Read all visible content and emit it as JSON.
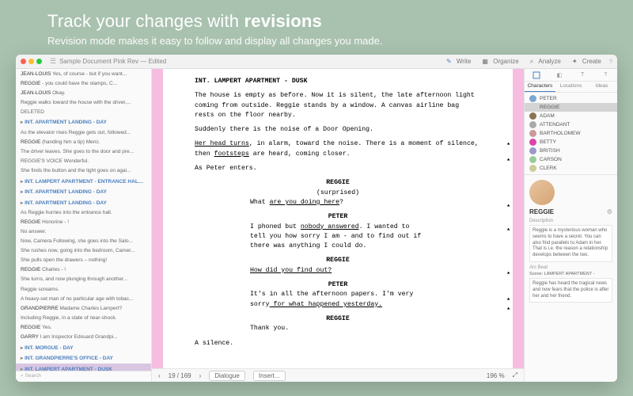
{
  "hero": {
    "title_a": "Track your changes with ",
    "title_b": "revisions",
    "sub": "Revision mode makes it easy to follow and display all changes you made."
  },
  "win": {
    "title": "Sample Document Pink Rev — Edited"
  },
  "tools": {
    "write": "Write",
    "organize": "Organize",
    "analyze": "Analyze",
    "create": "Create"
  },
  "outline": [
    {
      "t": "line",
      "ch": "JEAN-LOUIS",
      "txt": "Yes, of course - but if you want..."
    },
    {
      "t": "line",
      "ch": "REGGIE",
      "txt": "- you could have the stamps, C..."
    },
    {
      "t": "line",
      "ch": "JEAN-LOUIS",
      "txt": "Okay."
    },
    {
      "t": "line",
      "ch": "",
      "txt": "Reggie walks toward the house with the driver,..."
    },
    {
      "t": "line",
      "ch": "",
      "txt": "DELETED"
    },
    {
      "t": "sh",
      "txt": "INT. APARTMENT LANDING - DAY"
    },
    {
      "t": "line",
      "ch": "",
      "txt": "As the elevator rises Reggie gets out, followed..."
    },
    {
      "t": "line",
      "ch": "REGGIE",
      "txt": "(handing him a tip)  Merci."
    },
    {
      "t": "line",
      "ch": "",
      "txt": "The driver leaves. She goes to the door and pre..."
    },
    {
      "t": "line",
      "ch": "",
      "txt": "REGGIE'S VOICE Wonderful."
    },
    {
      "t": "line",
      "ch": "",
      "txt": "She finds the button and the light goes on agai..."
    },
    {
      "t": "sh",
      "txt": "INT. LAMPERT APARTMENT - ENTRANCE HALL -..."
    },
    {
      "t": "sh",
      "txt": "INT. APARTMENT LANDING - DAY"
    },
    {
      "t": "sh",
      "txt": "INT. APARTMENT LANDING - DAY"
    },
    {
      "t": "line",
      "ch": "",
      "txt": "As Reggie hurries into the entrance hall."
    },
    {
      "t": "line",
      "ch": "REGGIE",
      "txt": "Honorine - !"
    },
    {
      "t": "line",
      "ch": "",
      "txt": "No answer."
    },
    {
      "t": "line",
      "ch": "",
      "txt": "Now, Camera Following, she goes into the Salo..."
    },
    {
      "t": "line",
      "ch": "",
      "txt": "She rushes now, going into the bedroom, Camer..."
    },
    {
      "t": "line",
      "ch": "",
      "txt": "She pulls open the drawers – nothing!"
    },
    {
      "t": "line",
      "ch": "REGGIE",
      "txt": "Charles - !"
    },
    {
      "t": "line",
      "ch": "",
      "txt": "She turns, and now plunging through another..."
    },
    {
      "t": "line",
      "ch": "",
      "txt": "Reggie screams."
    },
    {
      "t": "line",
      "ch": "",
      "txt": "A heavy-set man of no particular age with tobac..."
    },
    {
      "t": "line",
      "ch": "GRANDPIERRE",
      "txt": "Madame Charles Lampert?"
    },
    {
      "t": "line",
      "ch": "",
      "txt": "Including Reggie, in a state of near-shock."
    },
    {
      "t": "line",
      "ch": "REGGIE",
      "txt": "Yes."
    },
    {
      "t": "line",
      "ch": "GARRY",
      "txt": "I am Inspector Edouard Grandpi..."
    },
    {
      "t": "sh",
      "txt": "INT. MORGUE - DAY"
    },
    {
      "t": "sh",
      "txt": "INT. GRANDPIERRE'S OFFICE - DAY"
    },
    {
      "t": "sh",
      "txt": "INT. LAMPERT APARTMENT - DUSK",
      "sel": true
    }
  ],
  "search_ph": "Search",
  "script": {
    "slug": "INT. LAMPERT APARTMENT - DUSK",
    "a1": "The house is empty as before. Now it is silent, the late afternoon light coming from outside. Reggie stands by a window. A canvas airline bag rests on the floor nearby.",
    "a2": "Suddenly there is the noise of a Door Opening.",
    "a3_a": "Her head turns",
    "a3_b": ", in alarm, toward the noise. There is a moment of silence, then ",
    "a3_c": "footsteps",
    "a3_d": " are heard, coming closer.",
    "a4": "As Peter enters.",
    "c1": "REGGIE",
    "p1": "(surprised)",
    "d1a": "What ",
    "d1b": "are you doing here",
    "d1c": "?",
    "c2": "PETER",
    "d2a": "I phoned but ",
    "d2b": "nobody answered",
    "d2c": ". I wanted to tell you how sorry I am - and to find out if there was anything I could do.",
    "c3": "REGGIE",
    "d3": "How did you find out?",
    "c4": "PETER",
    "d4a": "It's in all the afternoon papers. I'm very sorry",
    "d4b": " for what happened yesterday.",
    "c5": "REGGIE",
    "d5": "Thank you.",
    "a5": "A silence."
  },
  "bottom": {
    "pages": "19 / 169",
    "element": "Dialogue",
    "insert": "Insert...",
    "zoom": "196 %"
  },
  "sidetabs": {
    "characters": "Characters",
    "locations": "Locations",
    "ideas": "Ideas"
  },
  "chars": [
    {
      "n": "PETER",
      "c": "#7aa7d4"
    },
    {
      "n": "REGGIE",
      "c": "#d4d4d4",
      "sel": true
    },
    {
      "n": "ADAM",
      "c": "#8b7355"
    },
    {
      "n": "ATTENDANT",
      "c": "#aaa"
    },
    {
      "n": "BARTHOLOMEW",
      "c": "#c99"
    },
    {
      "n": "BETTY",
      "c": "#d4a"
    },
    {
      "n": "BRITISH",
      "c": "#99c"
    },
    {
      "n": "CARSON",
      "c": "#9c9"
    },
    {
      "n": "CLERK",
      "c": "#cc9"
    }
  ],
  "detail": {
    "name": "REGGIE",
    "desc_lbl": "Description",
    "desc": "Reggie is a mysterious woman who seems to have a secret. You can also find parallels to Adam in her. That is i.e. the reason a relationship develops between the two.",
    "arc_lbl": "Arc Beat",
    "scene": "Scene:  LAMPERT APARTMENT -",
    "arc": "Reggie has heard the tragical news and now fears that the police is after her and her friend."
  }
}
